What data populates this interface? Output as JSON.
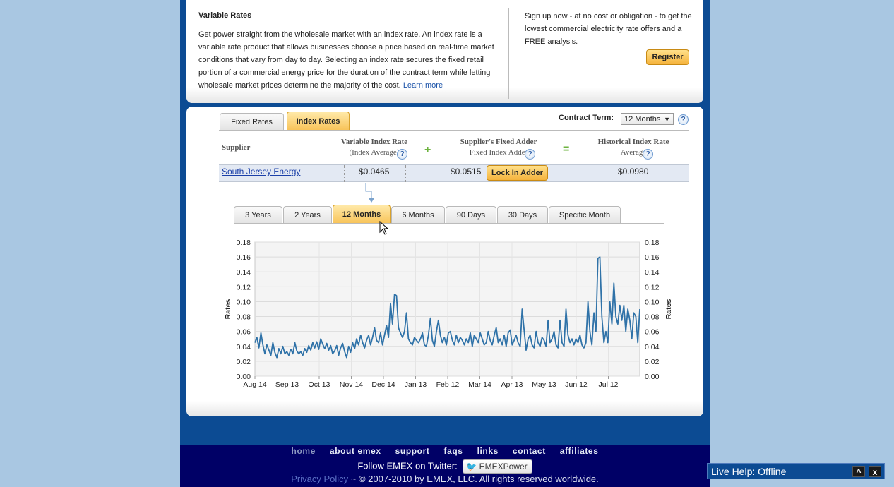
{
  "variable_rates": {
    "title": "Variable Rates",
    "description": "Get power straight from the wholesale market with an index rate. An index rate is a variable rate product that allows businesses choose a price based on real-time market conditions that vary from day to day. Selecting an index rate secures the fixed retail portion of a commercial energy price for the duration of the contract term while letting wholesale market prices determine the majority of the cost.",
    "learn_more": "Learn more"
  },
  "signup": {
    "text": "Sign up now - at no cost or obligation - to get the lowest commercial electricity rate offers and a FREE analysis.",
    "register_label": "Register"
  },
  "rate_tabs": [
    {
      "label": "Fixed Rates",
      "active": false
    },
    {
      "label": "Index Rates",
      "active": true
    }
  ],
  "contract_term": {
    "label": "Contract Term:",
    "selected": "12 Months",
    "help": "?"
  },
  "table": {
    "headers": {
      "supplier": "Supplier",
      "variable_index_rate": "Variable Index Rate",
      "variable_index_rate_sub": "(Index Average)",
      "fixed_adder": "Supplier's Fixed Adder",
      "fixed_adder_sub": "Fixed Index Adder",
      "historical": "Historical Index Rate",
      "historical_sub": "Average"
    },
    "plus_symbol": "+",
    "equals_symbol": "=",
    "row": {
      "supplier": "South Jersey Energy",
      "variable_index_rate": "$0.0465",
      "fixed_adder": "$0.0515",
      "lock_in_label": "Lock In Adder",
      "historical": "$0.0980"
    }
  },
  "period_tabs": [
    {
      "label": "3 Years",
      "active": false
    },
    {
      "label": "2 Years",
      "active": false
    },
    {
      "label": "12 Months",
      "active": true
    },
    {
      "label": "6 Months",
      "active": false
    },
    {
      "label": "90 Days",
      "active": false
    },
    {
      "label": "30 Days",
      "active": false
    },
    {
      "label": "Specific Month",
      "active": false
    }
  ],
  "chart_data": {
    "type": "line",
    "title": "",
    "xlabel": "",
    "ylabel": "Rates",
    "ylabel_right": "Rates",
    "ylim": [
      0,
      0.18
    ],
    "yticks": [
      "0.18",
      "0.16",
      "0.14",
      "0.12",
      "0.10",
      "0.08",
      "0.06",
      "0.04",
      "0.02",
      "0.00"
    ],
    "xticks": [
      "Aug 14",
      "Sep 13",
      "Oct 13",
      "Nov 14",
      "Dec 14",
      "Jan 13",
      "Feb 12",
      "Mar 14",
      "Apr 13",
      "May 13",
      "Jun 12",
      "Jul 12"
    ],
    "grid": true,
    "legend": "none",
    "line_color": "#2f72a8",
    "series": [
      {
        "values": [
          0.045,
          0.052,
          0.038,
          0.058,
          0.042,
          0.03,
          0.042,
          0.035,
          0.028,
          0.045,
          0.032,
          0.025,
          0.037,
          0.03,
          0.04,
          0.03,
          0.033,
          0.028,
          0.036,
          0.03,
          0.045,
          0.034,
          0.03,
          0.033,
          0.028,
          0.037,
          0.032,
          0.041,
          0.035,
          0.045,
          0.038,
          0.046,
          0.036,
          0.05,
          0.043,
          0.037,
          0.044,
          0.035,
          0.041,
          0.03,
          0.034,
          0.041,
          0.028,
          0.038,
          0.044,
          0.033,
          0.025,
          0.04,
          0.032,
          0.045,
          0.037,
          0.05,
          0.042,
          0.055,
          0.045,
          0.038,
          0.048,
          0.055,
          0.042,
          0.052,
          0.065,
          0.048,
          0.045,
          0.058,
          0.042,
          0.055,
          0.068,
          0.052,
          0.098,
          0.07,
          0.11,
          0.108,
          0.065,
          0.058,
          0.052,
          0.06,
          0.085,
          0.05,
          0.045,
          0.042,
          0.052,
          0.048,
          0.045,
          0.05,
          0.058,
          0.042,
          0.04,
          0.055,
          0.078,
          0.048,
          0.04,
          0.06,
          0.075,
          0.055,
          0.045,
          0.052,
          0.042,
          0.058,
          0.06,
          0.048,
          0.042,
          0.055,
          0.045,
          0.052,
          0.048,
          0.042,
          0.05,
          0.045,
          0.058,
          0.04,
          0.055,
          0.05,
          0.045,
          0.058,
          0.05,
          0.042,
          0.045,
          0.06,
          0.048,
          0.042,
          0.055,
          0.065,
          0.045,
          0.05,
          0.042,
          0.055,
          0.04,
          0.058,
          0.062,
          0.042,
          0.048,
          0.055,
          0.045,
          0.04,
          0.09,
          0.062,
          0.035,
          0.05,
          0.055,
          0.042,
          0.038,
          0.06,
          0.045,
          0.04,
          0.052,
          0.048,
          0.04,
          0.075,
          0.045,
          0.05,
          0.06,
          0.042,
          0.038,
          0.075,
          0.045,
          0.04,
          0.09,
          0.055,
          0.045,
          0.05,
          0.042,
          0.05,
          0.045,
          0.055,
          0.042,
          0.038,
          0.045,
          0.1,
          0.06,
          0.042,
          0.085,
          0.06,
          0.158,
          0.16,
          0.08,
          0.045,
          0.06,
          0.045,
          0.1,
          0.07,
          0.125,
          0.08,
          0.07,
          0.095,
          0.075,
          0.095,
          0.06,
          0.09,
          0.075,
          0.05,
          0.085,
          0.08,
          0.045,
          0.09
        ]
      }
    ]
  },
  "footer": {
    "nav": [
      "home",
      "about emex",
      "support",
      "faqs",
      "links",
      "contact",
      "affiliates"
    ],
    "follow_text": "Follow EMEX on Twitter:",
    "twitter_button": "EMEXPower",
    "privacy_policy": "Privacy Policy",
    "copyright": "~ © 2007-2010 by EMEX, LLC. All rights reserved worldwide."
  },
  "live_help": {
    "label": "Live Help: Offline",
    "expand": "^",
    "close": "x"
  }
}
